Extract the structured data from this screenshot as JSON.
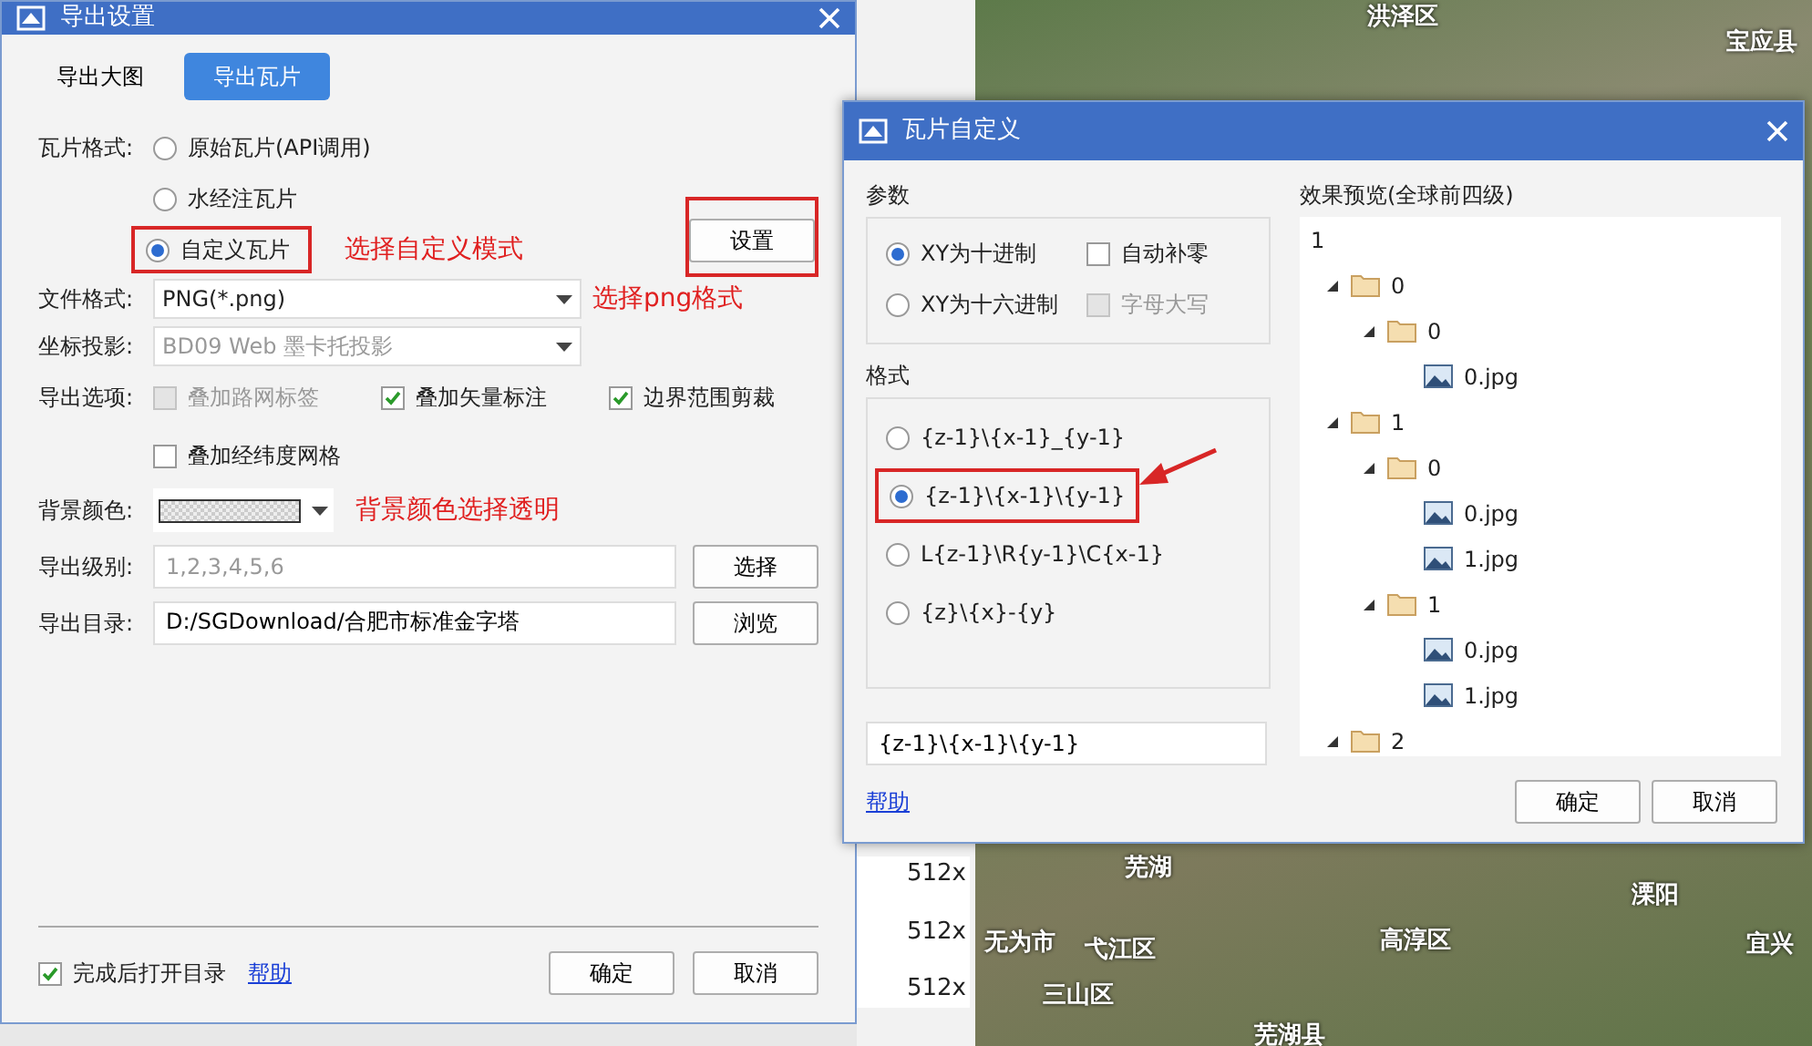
{
  "map": {
    "labels": [
      {
        "text": "洪泽区"
      },
      {
        "text": "宝应县"
      },
      {
        "text": "芜湖"
      },
      {
        "text": "无为市"
      },
      {
        "text": "弋江区"
      },
      {
        "text": "三山区"
      },
      {
        "text": "高淳区"
      },
      {
        "text": "溧阳"
      },
      {
        "text": "宜兴"
      },
      {
        "text": "芜湖县"
      }
    ]
  },
  "size_column": [
    "512x",
    "512x",
    "512x"
  ],
  "export_dialog": {
    "title": "导出设置",
    "tabs": [
      {
        "label": "导出大图",
        "selected": false
      },
      {
        "label": "导出瓦片",
        "selected": true
      }
    ],
    "tile_format": {
      "label": "瓦片格式:",
      "options": [
        {
          "label": "原始瓦片(API调用)",
          "selected": false
        },
        {
          "label": "水经注瓦片",
          "selected": false
        },
        {
          "label": "自定义瓦片",
          "selected": true
        }
      ],
      "settings_button": "设置",
      "annotation": "选择自定义模式"
    },
    "file_format": {
      "label": "文件格式:",
      "value": "PNG(*.png)",
      "disabled": false,
      "annotation": "选择png格式"
    },
    "projection": {
      "label": "坐标投影:",
      "value": "BD09 Web 墨卡托投影",
      "disabled": true
    },
    "export_options": {
      "label": "导出选项:",
      "items": [
        {
          "label": "叠加路网标签",
          "checked": false,
          "disabled": true
        },
        {
          "label": "叠加矢量标注",
          "checked": true,
          "disabled": false
        },
        {
          "label": "边界范围剪裁",
          "checked": true,
          "disabled": false
        },
        {
          "label": "叠加经纬度网格",
          "checked": false,
          "disabled": false
        }
      ]
    },
    "background_color": {
      "label": "背景颜色:",
      "annotation": "背景颜色选择透明"
    },
    "levels": {
      "label": "导出级别:",
      "placeholder": "1,2,3,4,5,6",
      "button": "选择"
    },
    "directory": {
      "label": "导出目录:",
      "value": "D:/SGDownload/合肥市标准金字塔",
      "button": "浏览"
    },
    "open_after": {
      "label": "完成后打开目录",
      "checked": true
    },
    "help_link": "帮助",
    "ok_button": "确定",
    "cancel_button": "取消"
  },
  "tile_dialog": {
    "title": "瓦片自定义",
    "params": {
      "title": "参数",
      "radios": [
        {
          "label": "XY为十进制",
          "selected": true
        },
        {
          "label": "XY为十六进制",
          "selected": false
        }
      ],
      "checkboxes": [
        {
          "label": "自动补零",
          "checked": false,
          "disabled": false
        },
        {
          "label": "字母大写",
          "checked": false,
          "disabled": true
        }
      ]
    },
    "format": {
      "title": "格式",
      "options": [
        {
          "label": "{z-1}\\{x-1}_{y-1}",
          "selected": false
        },
        {
          "label": "{z-1}\\{x-1}\\{y-1}",
          "selected": true
        },
        {
          "label": "L{z-1}\\R{y-1}\\C{x-1}",
          "selected": false
        },
        {
          "label": "{z}\\{x}-{y}",
          "selected": false
        }
      ]
    },
    "format_field": {
      "value": "{z-1}\\{x-1}\\{y-1}"
    },
    "preview": {
      "title": "效果预览(全球前四级)",
      "root": "1",
      "tree": [
        {
          "label": "0",
          "kind": "folder",
          "expanded": true,
          "children": [
            {
              "label": "0",
              "kind": "folder",
              "expanded": true,
              "children": [
                {
                  "label": "0.jpg",
                  "kind": "image"
                }
              ]
            }
          ]
        },
        {
          "label": "1",
          "kind": "folder",
          "expanded": true,
          "children": [
            {
              "label": "0",
              "kind": "folder",
              "expanded": true,
              "children": [
                {
                  "label": "0.jpg",
                  "kind": "image"
                },
                {
                  "label": "1.jpg",
                  "kind": "image"
                }
              ]
            },
            {
              "label": "1",
              "kind": "folder",
              "expanded": true,
              "children": [
                {
                  "label": "0.jpg",
                  "kind": "image"
                },
                {
                  "label": "1.jpg",
                  "kind": "image"
                }
              ]
            }
          ]
        },
        {
          "label": "2",
          "kind": "folder",
          "expanded": true
        }
      ]
    },
    "help_link": "帮助",
    "ok_button": "确定",
    "cancel_button": "取消"
  }
}
